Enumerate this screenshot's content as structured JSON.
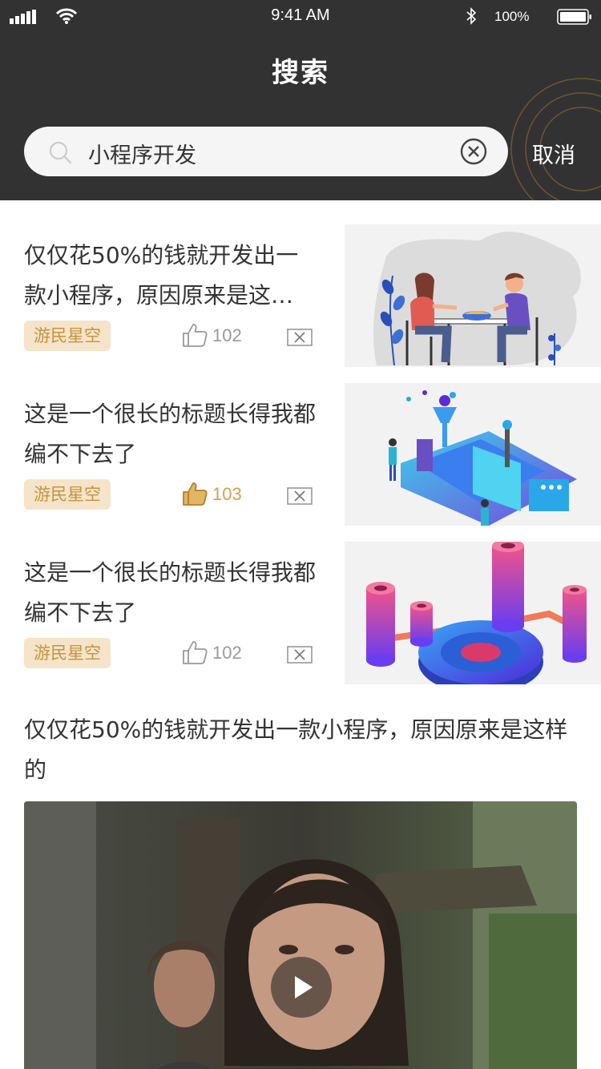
{
  "status_bar": {
    "time": "9:41 AM",
    "battery": "100%"
  },
  "header": {
    "title": "搜索",
    "cancel_label": "取消"
  },
  "search": {
    "value": "小程序开发",
    "icon": "search-icon",
    "clear_icon": "clear-icon"
  },
  "colors": {
    "header_bg": "#333232",
    "tag_bg": "#f5e4c9",
    "tag_text": "#c7933d",
    "like_active": "#d3a04a"
  },
  "articles": [
    {
      "title": "仅仅花50%的钱就开发出一款小程序，原因原来是这…",
      "tag": "游民星空",
      "likes": "102",
      "liked": false
    },
    {
      "title": "这是一个很长的标题长得我都编不下去了",
      "tag": "游民星空",
      "likes": "103",
      "liked": true
    },
    {
      "title": "这是一个很长的标题长得我都编不下去了",
      "tag": "游民星空",
      "likes": "102",
      "liked": false
    }
  ],
  "video_article": {
    "title": "仅仅花50%的钱就开发出一款小程序，原因原来是这样的",
    "play_icon": "play-icon"
  }
}
